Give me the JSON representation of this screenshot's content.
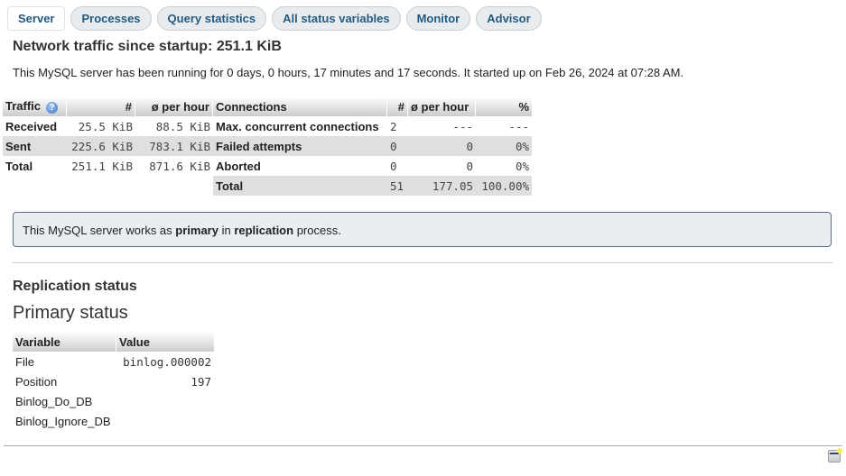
{
  "tabs": [
    {
      "label": "Server",
      "active": true
    },
    {
      "label": "Processes"
    },
    {
      "label": "Query statistics"
    },
    {
      "label": "All status variables"
    },
    {
      "label": "Monitor"
    },
    {
      "label": "Advisor"
    }
  ],
  "network": {
    "title": "Network traffic since startup: 251.1 KiB",
    "uptime": "This MySQL server has been running for 0 days, 0 hours, 17 minutes and 17 seconds. It started up on Feb 26, 2024 at 07:28 AM."
  },
  "traffic_table": {
    "headers": [
      "Traffic",
      "#",
      "ø per hour",
      "Connections",
      "#",
      "ø per hour",
      "%"
    ],
    "help_icon": "help-icon",
    "rows": [
      [
        "Received",
        "25.5 KiB",
        "88.5 KiB",
        "Max. concurrent connections",
        "2",
        "---",
        "---"
      ],
      [
        "Sent",
        "225.6 KiB",
        "783.1 KiB",
        "Failed attempts",
        "0",
        "0",
        "0%"
      ],
      [
        "Total",
        "251.1 KiB",
        "871.6 KiB",
        "Aborted",
        "0",
        "0",
        "0%"
      ],
      [
        "",
        "",
        "",
        "Total",
        "51",
        "177.05",
        "100.00%"
      ]
    ]
  },
  "replication_notice": {
    "prefix": "This MySQL server works as ",
    "role": "primary",
    "middle": " in ",
    "process": "replication",
    "suffix": " process."
  },
  "replication": {
    "heading": "Replication status",
    "subheading": "Primary status",
    "headers": [
      "Variable",
      "Value"
    ],
    "rows": [
      [
        "File",
        "binlog.000002"
      ],
      [
        "Position",
        "197"
      ],
      [
        "Binlog_Do_DB",
        ""
      ],
      [
        "Binlog_Ignore_DB",
        ""
      ]
    ]
  },
  "console_icon": "console-icon"
}
